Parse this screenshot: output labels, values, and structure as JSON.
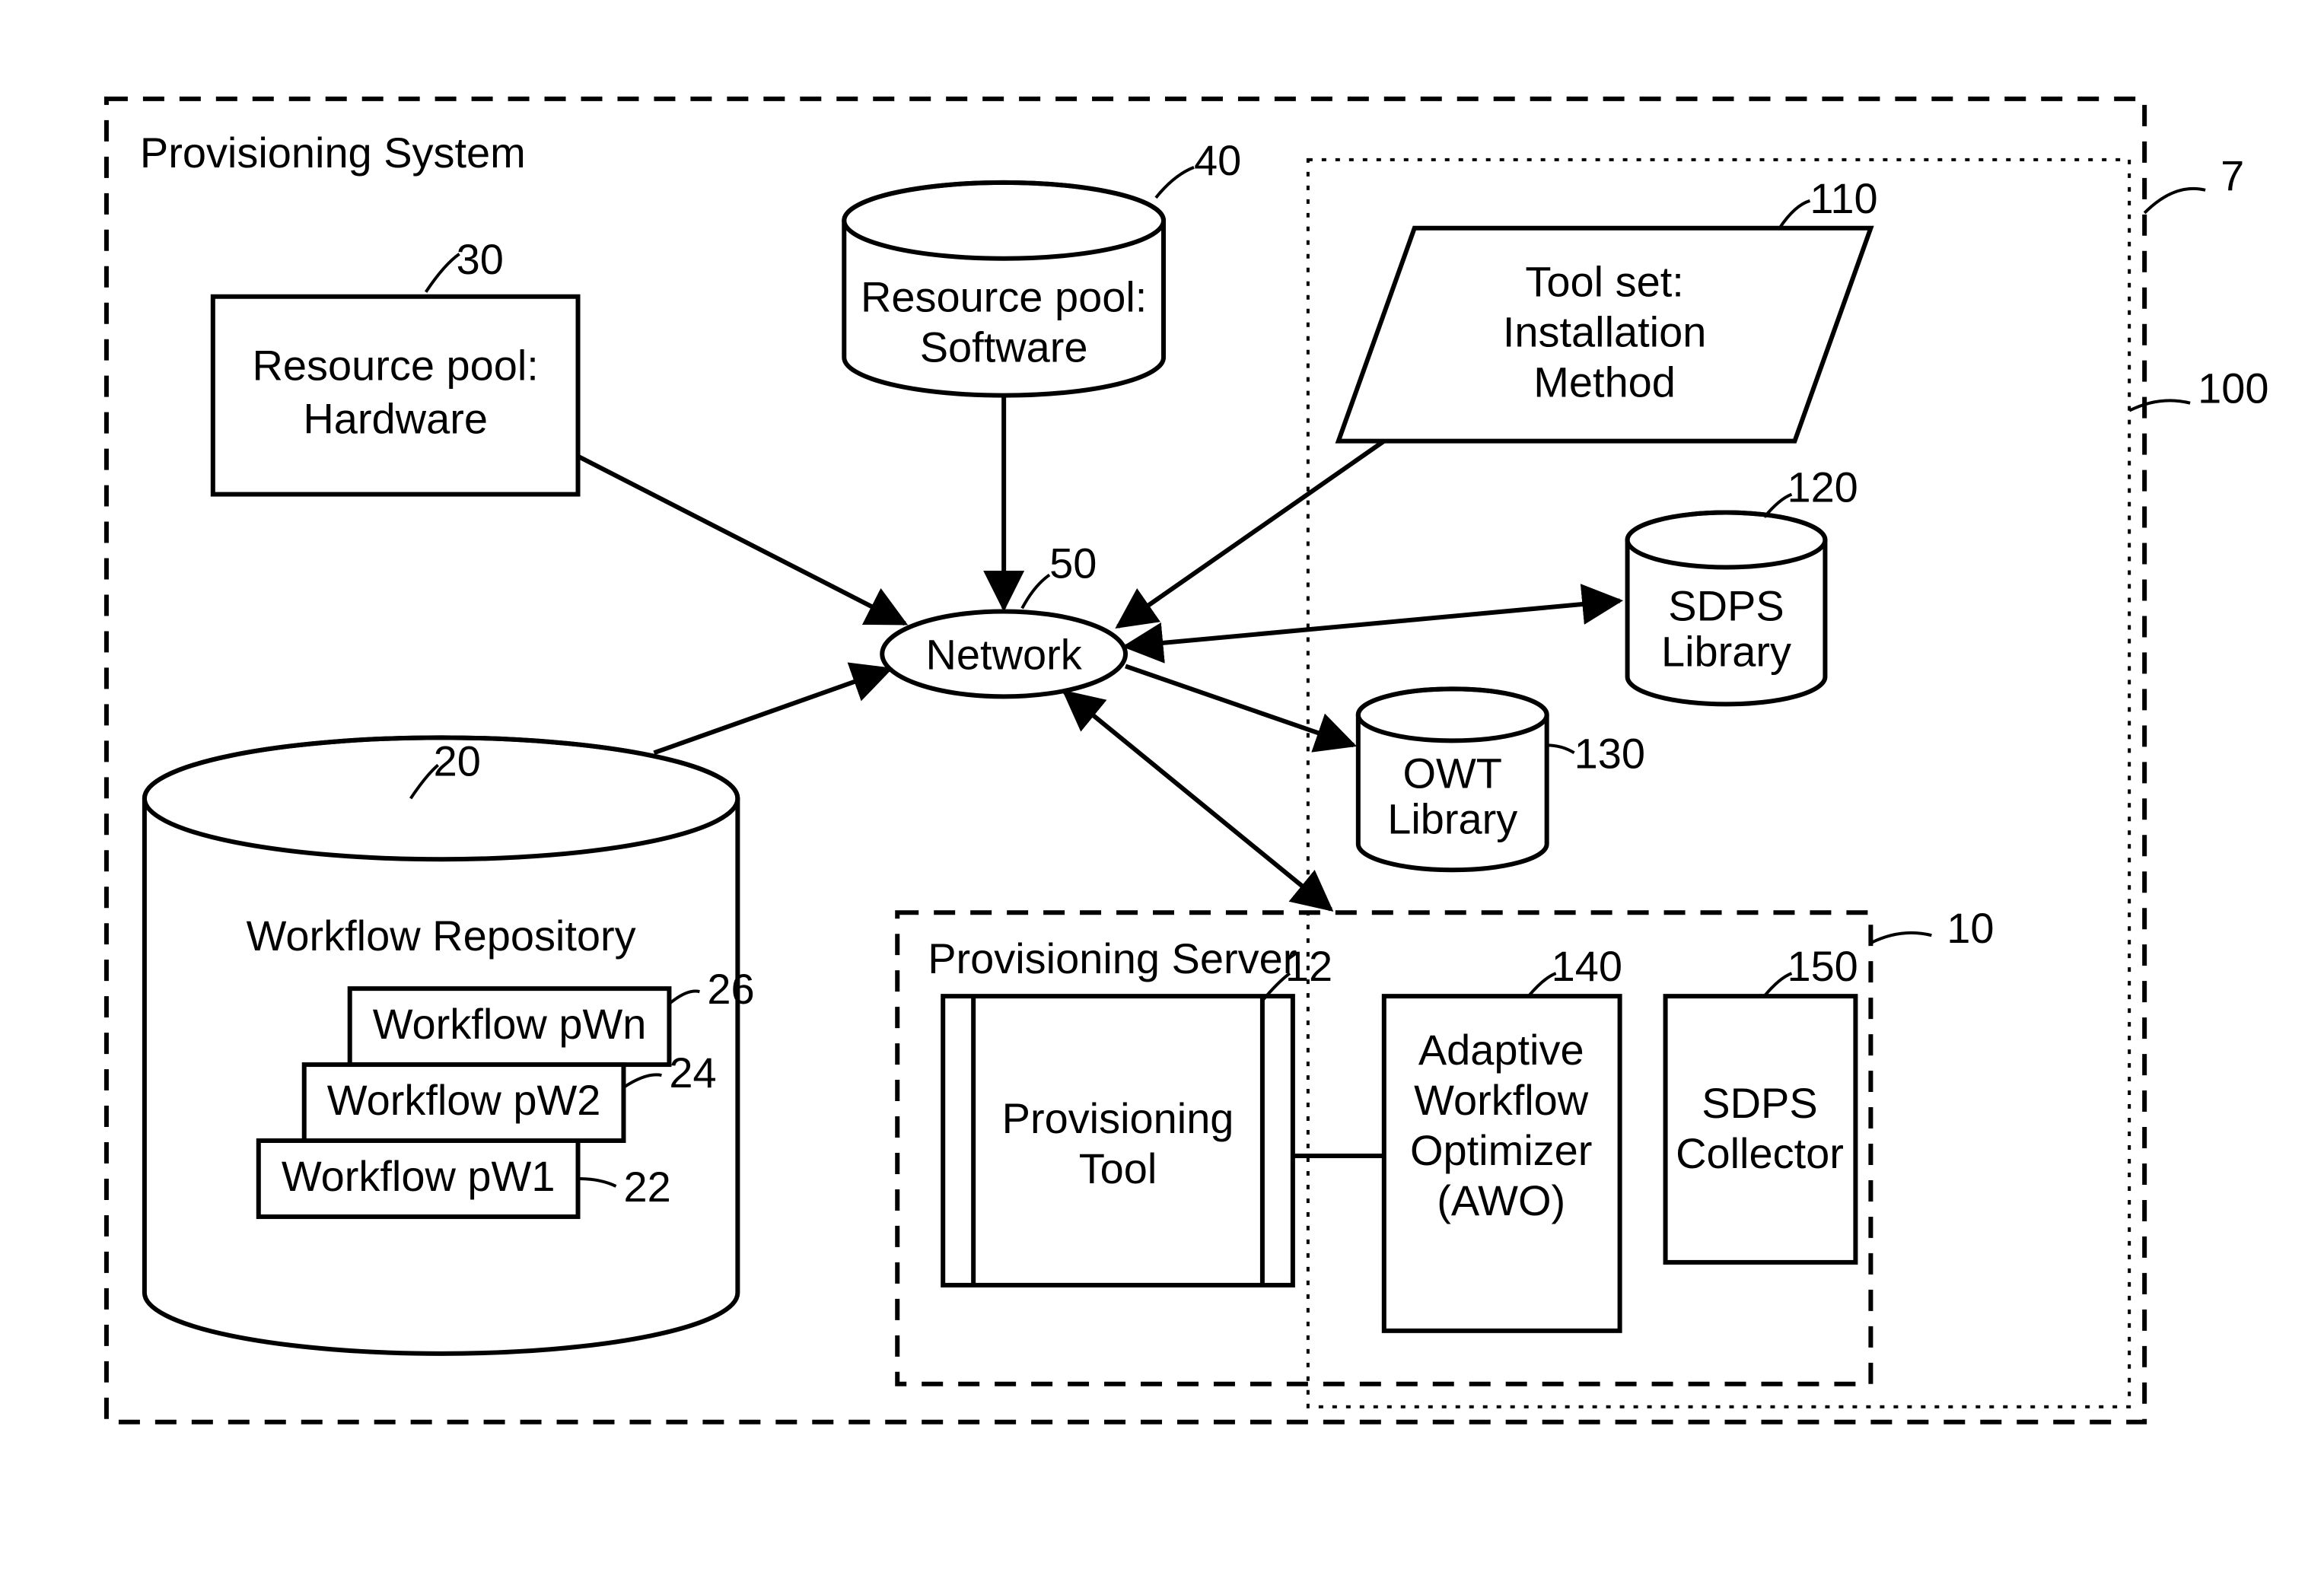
{
  "system": {
    "title": "Provisioning System",
    "ref": "7"
  },
  "hardware": {
    "line1": "Resource pool:",
    "line2": "Hardware",
    "ref": "30"
  },
  "software": {
    "line1": "Resource pool:",
    "line2": "Software",
    "ref": "40"
  },
  "network": {
    "label": "Network",
    "ref": "50"
  },
  "repo": {
    "title": "Workflow Repository",
    "ref": "20",
    "w1": {
      "label": "Workflow pW1",
      "ref": "22"
    },
    "w2": {
      "label": "Workflow pW2",
      "ref": "24"
    },
    "wn": {
      "label": "Workflow pWn",
      "ref": "26"
    }
  },
  "toolset": {
    "line1": "Tool set:",
    "line2": "Installation",
    "line3": "Method",
    "ref": "110"
  },
  "sdps": {
    "line1": "SDPS",
    "line2": "Library",
    "ref": "120"
  },
  "owt": {
    "line1": "OWT",
    "line2": "Library",
    "ref": "130"
  },
  "server": {
    "title": "Provisioning Server",
    "ref": "10",
    "tool": {
      "line1": "Provisioning",
      "line2": "Tool",
      "ref": "12"
    },
    "awo": {
      "line1": "Adaptive",
      "line2": "Workflow",
      "line3": "Optimizer",
      "line4": "(AWO)",
      "ref": "140"
    },
    "coll": {
      "line1": "SDPS",
      "line2": "Collector",
      "ref": "150"
    }
  },
  "subset": {
    "ref": "100"
  }
}
